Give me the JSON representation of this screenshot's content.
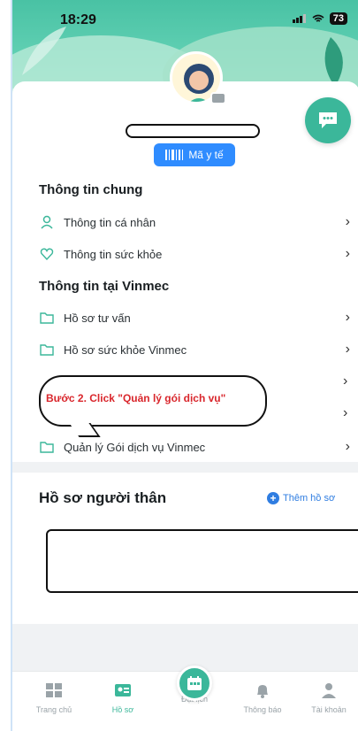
{
  "status_bar": {
    "time": "18:29",
    "battery": "73"
  },
  "profile": {
    "ma_y_te_label": "Mã y tế"
  },
  "general": {
    "title": "Thông tin chung",
    "items": [
      {
        "label": "Thông tin cá nhân",
        "icon": "person-icon"
      },
      {
        "label": "Thông tin sức khỏe",
        "icon": "heart-icon"
      }
    ]
  },
  "vinmec": {
    "title": "Thông tin tại Vinmec",
    "items": [
      {
        "label": "Hồ sơ tư vấn",
        "icon": "folder-icon"
      },
      {
        "label": "Hồ sơ sức khỏe Vinmec",
        "icon": "folder-icon"
      },
      {
        "label": "Quản lý Gói dịch vụ Vinmec",
        "icon": "folder-icon"
      }
    ]
  },
  "callout": {
    "text": "Bước 2. Click \"Quản lý gói dịch vụ\""
  },
  "relatives": {
    "title": "Hồ sơ người thân",
    "add_label": "Thêm hồ sơ"
  },
  "tabbar": {
    "tabs": [
      {
        "label": "Trang chủ"
      },
      {
        "label": "Hồ sơ"
      },
      {
        "label": "Đặt lịch"
      },
      {
        "label": "Thông báo"
      },
      {
        "label": "Tài khoản"
      }
    ]
  },
  "colors": {
    "accent": "#3bb79a",
    "link": "#2f7de1",
    "callout_text": "#d9262c"
  }
}
